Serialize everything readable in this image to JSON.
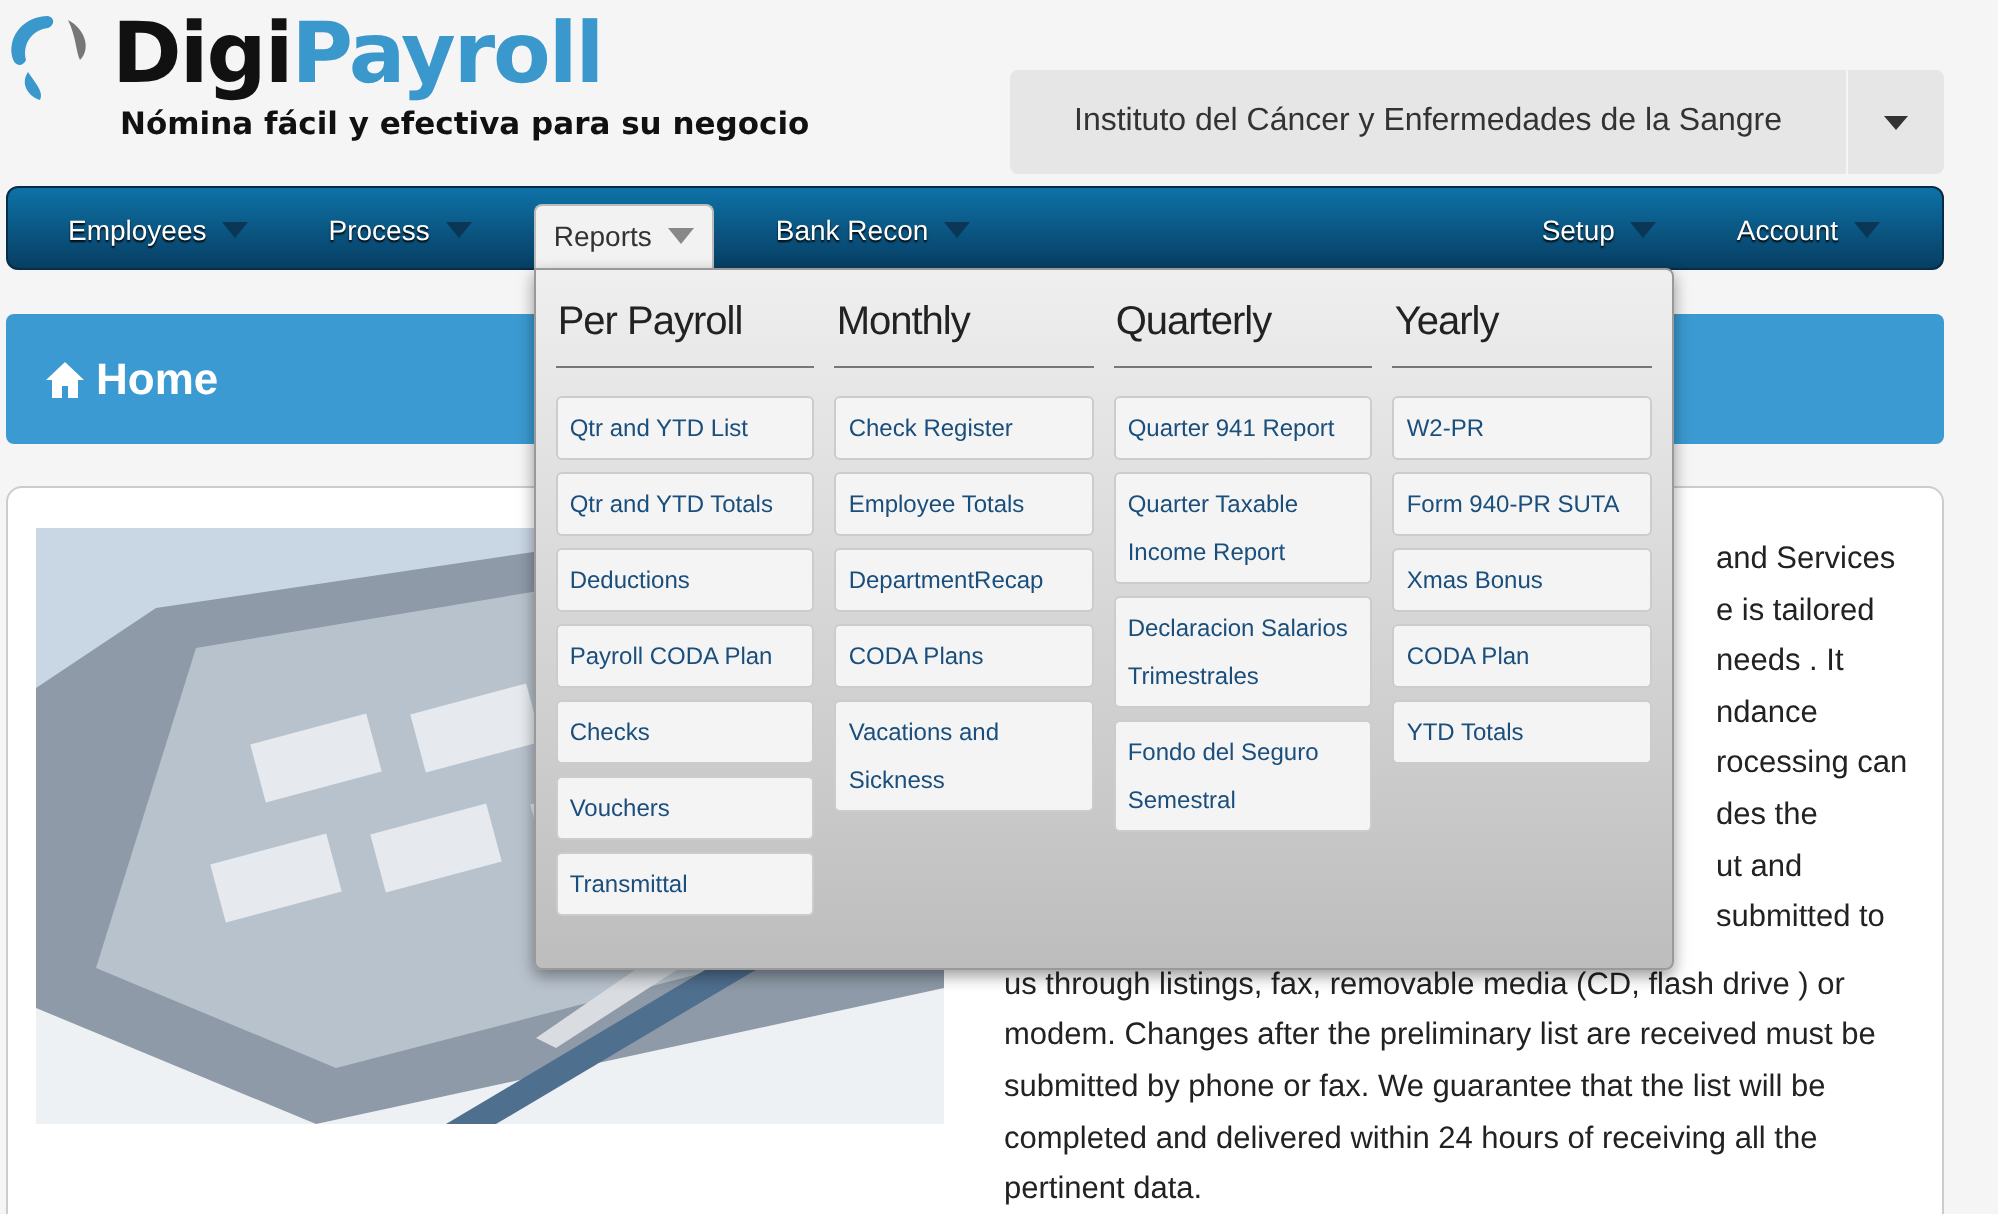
{
  "logo": {
    "brand_dark": "Digi",
    "brand_light": "Payroll",
    "tagline": "Nómina fácil y efectiva para su negocio"
  },
  "company_select": {
    "value": "Instituto del Cáncer y Enfermedades de la Sangre"
  },
  "nav": {
    "left": [
      {
        "label": "Employees",
        "selected": false
      },
      {
        "label": "Process",
        "selected": false
      },
      {
        "label": "Reports",
        "selected": true
      },
      {
        "label": "Bank Recon",
        "selected": false
      }
    ],
    "right": [
      {
        "label": "Setup",
        "selected": false
      },
      {
        "label": "Account",
        "selected": false
      }
    ]
  },
  "reports_menu": {
    "columns": [
      {
        "heading": "Per Payroll",
        "items": [
          "Qtr and YTD List",
          "Qtr and YTD Totals",
          "Deductions",
          "Payroll CODA Plan",
          "Checks",
          "Vouchers",
          "Transmittal"
        ]
      },
      {
        "heading": "Monthly",
        "items": [
          "Check Register",
          "Employee Totals",
          "DepartmentRecap",
          "CODA Plans",
          "Vacations and Sickness"
        ]
      },
      {
        "heading": "Quarterly",
        "items": [
          "Quarter 941 Report",
          "Quarter Taxable Income Report",
          "Declaracion Salarios Trimestrales",
          "Fondo del Seguro Semestral"
        ]
      },
      {
        "heading": "Yearly",
        "items": [
          "W2-PR",
          "Form 940-PR SUTA",
          "Xmas Bonus",
          "CODA Plan",
          "YTD Totals"
        ]
      }
    ]
  },
  "page_title": "Home",
  "content": {
    "lines_beside_menu": [
      "and Services",
      "e is tailored",
      "needs . It",
      "ndance",
      "rocessing can",
      "des the",
      "ut and",
      "submitted to"
    ],
    "lines": [
      "us through listings, fax, removable media (CD, flash drive ) or",
      "modem. Changes after the preliminary list are received must be",
      "submitted by phone or fax. We guarantee that the list will be",
      "completed and delivered within 24 hours of receiving all the",
      "pertinent data."
    ]
  }
}
